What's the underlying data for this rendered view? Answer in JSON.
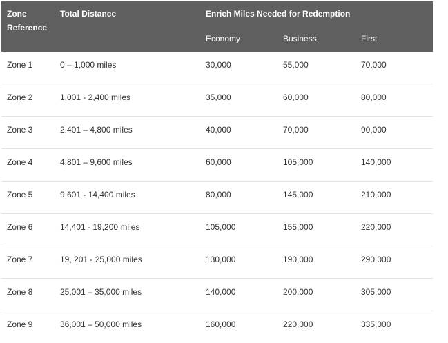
{
  "header": {
    "zone": "Zone Reference",
    "distance": "Total Distance",
    "group": "Enrich Miles Needed for Redemption",
    "economy": "Economy",
    "business": "Business",
    "first": "First"
  },
  "rows": [
    {
      "zone": "Zone 1",
      "distance": "0 – 1,000 miles",
      "economy": "30,000",
      "business": "55,000",
      "first": "70,000"
    },
    {
      "zone": "Zone 2",
      "distance": "1,001 - 2,400 miles",
      "economy": "35,000",
      "business": "60,000",
      "first": "80,000"
    },
    {
      "zone": "Zone 3",
      "distance": "2,401 – 4,800 miles",
      "economy": "40,000",
      "business": "70,000",
      "first": "90,000"
    },
    {
      "zone": "Zone 4",
      "distance": "4,801 – 9,600 miles",
      "economy": "60,000",
      "business": "105,000",
      "first": "140,000"
    },
    {
      "zone": "Zone 5",
      "distance": "9,601 - 14,400 miles",
      "economy": "80,000",
      "business": "145,000",
      "first": "210,000"
    },
    {
      "zone": "Zone 6",
      "distance": "14,401 - 19,200 miles",
      "economy": "105,000",
      "business": "155,000",
      "first": "220,000"
    },
    {
      "zone": "Zone 7",
      "distance": "19, 201 - 25,000 miles",
      "economy": "130,000",
      "business": "190,000",
      "first": "290,000"
    },
    {
      "zone": "Zone 8",
      "distance": "25,001 – 35,000 miles",
      "economy": "140,000",
      "business": "200,000",
      "first": "305,000"
    },
    {
      "zone": "Zone 9",
      "distance": "36,001 – 50,000 miles",
      "economy": "160,000",
      "business": "220,000",
      "first": "335,000"
    }
  ]
}
